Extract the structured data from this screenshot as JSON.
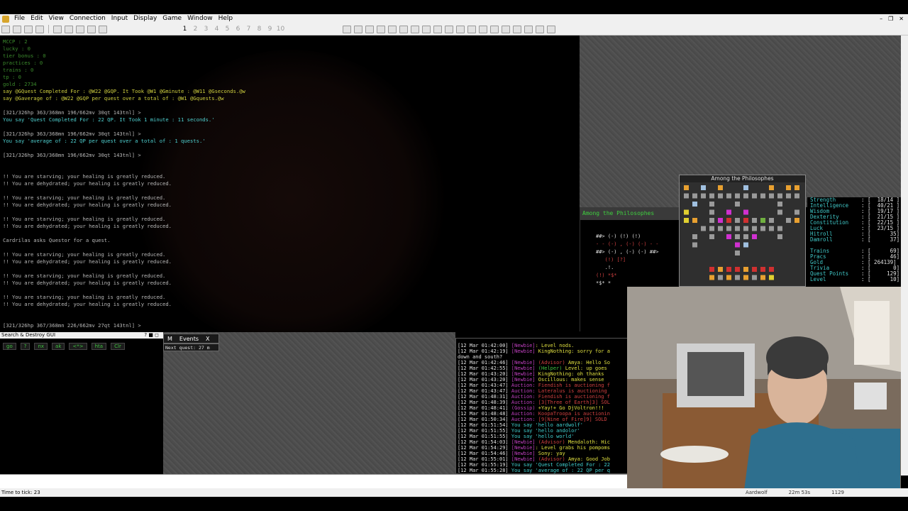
{
  "menu": [
    "File",
    "Edit",
    "View",
    "Connection",
    "Input",
    "Display",
    "Game",
    "Window",
    "Help"
  ],
  "toolbar_numbers": [
    "1",
    "2",
    "3",
    "4",
    "5",
    "6",
    "7",
    "8",
    "9",
    "10"
  ],
  "output": [
    {
      "t": "MCCP : 2",
      "c": "c-green"
    },
    {
      "t": "lucky : 0",
      "c": "c-green"
    },
    {
      "t": "tier bonus : 0",
      "c": "c-green"
    },
    {
      "t": "practices : 0",
      "c": "c-green"
    },
    {
      "t": "trains : 0",
      "c": "c-green"
    },
    {
      "t": "tp : 0",
      "c": "c-green"
    },
    {
      "t": "gold : 2734",
      "c": "c-green"
    },
    {
      "t": "say @GQuest Completed For : @W22 @GQP. It Took @W1 @Gminute : @W11 @Gseconds.@w",
      "c": "c-yellow"
    },
    {
      "t": "say @Gaverage of : @W22 @GQP per quest over a total of : @W1 @Gquests.@w",
      "c": "c-yellow"
    },
    {
      "t": "",
      "c": "c-grey"
    },
    {
      "t": "[321/326hp 363/368mn 196/662mv 30qt 143tnl] >",
      "c": "c-grey"
    },
    {
      "t": "You say 'Quest Completed For : 22 QP. It Took 1 minute : 11 seconds.'",
      "c": "c-cyan"
    },
    {
      "t": "",
      "c": "c-grey"
    },
    {
      "t": "[321/326hp 363/368mn 196/662mv 30qt 143tnl] >",
      "c": "c-grey"
    },
    {
      "t": "You say 'average of : 22 QP per quest over a total of : 1 quests.'",
      "c": "c-cyan"
    },
    {
      "t": "",
      "c": "c-grey"
    },
    {
      "t": "[321/326hp 363/368mn 196/662mv 30qt 143tnl] >",
      "c": "c-grey"
    },
    {
      "t": "",
      "c": "c-grey"
    },
    {
      "t": "",
      "c": "c-grey"
    },
    {
      "t": "!! You are starving; your healing is greatly reduced.",
      "c": "c-grey"
    },
    {
      "t": "!! You are dehydrated; your healing is greatly reduced.",
      "c": "c-grey"
    },
    {
      "t": "",
      "c": "c-grey"
    },
    {
      "t": "!! You are starving; your healing is greatly reduced.",
      "c": "c-grey"
    },
    {
      "t": "!! You are dehydrated; your healing is greatly reduced.",
      "c": "c-grey"
    },
    {
      "t": "",
      "c": "c-grey"
    },
    {
      "t": "!! You are starving; your healing is greatly reduced.",
      "c": "c-grey"
    },
    {
      "t": "!! You are dehydrated; your healing is greatly reduced.",
      "c": "c-grey"
    },
    {
      "t": "",
      "c": "c-grey"
    },
    {
      "t": "Cardrilas asks Questor for a quest.",
      "c": "c-grey"
    },
    {
      "t": "",
      "c": "c-grey"
    },
    {
      "t": "!! You are starving; your healing is greatly reduced.",
      "c": "c-grey"
    },
    {
      "t": "!! You are dehydrated; your healing is greatly reduced.",
      "c": "c-grey"
    },
    {
      "t": "",
      "c": "c-grey"
    },
    {
      "t": "!! You are starving; your healing is greatly reduced.",
      "c": "c-grey"
    },
    {
      "t": "!! You are dehydrated; your healing is greatly reduced.",
      "c": "c-grey"
    },
    {
      "t": "",
      "c": "c-grey"
    },
    {
      "t": "!! You are starving; your healing is greatly reduced.",
      "c": "c-grey"
    },
    {
      "t": "!! You are dehydrated; your healing is greatly reduced.",
      "c": "c-grey"
    },
    {
      "t": "",
      "c": "c-grey"
    },
    {
      "t": "",
      "c": "c-grey"
    },
    {
      "t": "[321/326hp 367/368mn 226/662mv 27qt 143tnl] >",
      "c": "c-grey"
    }
  ],
  "area": {
    "title": "Among the Philosophes",
    "minimap": [
      "##> (-) (!) (!)",
      "- - (-) , (-) (-) - -",
      "##> (-) , (-) (-) ##>",
      "   (!) [?]",
      "   .!.",
      "(!) *$*",
      "*$* *"
    ]
  },
  "map": {
    "title": "Among the Philosophes"
  },
  "stats": [
    {
      "name": "Strength",
      "val": "[  18/14 ]"
    },
    {
      "name": "Intelligence",
      "val": "[  40/21 ]"
    },
    {
      "name": "Wisdom",
      "val": "[  19/17 ]"
    },
    {
      "name": "Dexterity",
      "val": "[  21/15 ]"
    },
    {
      "name": "Constitution",
      "val": "[  22/15 ]"
    },
    {
      "name": "Luck",
      "val": "[  23/15 ]"
    },
    {
      "name": "Hitroll",
      "val": "[      35]"
    },
    {
      "name": "Damroll",
      "val": "[      37]"
    }
  ],
  "stats2": [
    {
      "name": "Trains",
      "val": "[      69]"
    },
    {
      "name": "Pracs",
      "val": "[      46]"
    },
    {
      "name": "Gold",
      "val": "[ 264139]"
    },
    {
      "name": "Trivia",
      "val": "[       0]"
    },
    {
      "name": "Quest Points",
      "val": "[     129]"
    },
    {
      "name": "Level",
      "val": "[      10]"
    }
  ],
  "sd": {
    "title": "Search & Destroy GUI",
    "buttons": [
      "go",
      "?",
      "nx",
      "ak",
      "<*>",
      "hta",
      "Clr"
    ]
  },
  "events": {
    "tab1": "M",
    "tab2": "Events",
    "close": "X",
    "body": "Next quest: 27 m"
  },
  "chat": [
    {
      "ts": "[12 Mar 01:42:00]",
      "parts": [
        {
          "t": " [Newbie]",
          "c": "ch-m"
        },
        {
          "t": ": Level nods.",
          "c": "ch-y"
        }
      ]
    },
    {
      "ts": "[12 Mar 01:42:19]",
      "parts": [
        {
          "t": " [Newbie]",
          "c": "ch-m"
        },
        {
          "t": " KingNothing: sorry for a",
          "c": "ch-y"
        }
      ]
    },
    {
      "ts": "down and south?",
      "parts": []
    },
    {
      "ts": "[12 Mar 01:42:46]",
      "parts": [
        {
          "t": " [Newbie]",
          "c": "ch-m"
        },
        {
          "t": " (Advisor)",
          "c": "ch-r"
        },
        {
          "t": " Amya: Hello So",
          "c": "ch-y"
        }
      ]
    },
    {
      "ts": "[12 Mar 01:42:55]",
      "parts": [
        {
          "t": " [Newbie]",
          "c": "ch-m"
        },
        {
          "t": " (Helper)",
          "c": "ch-g"
        },
        {
          "t": " Level: up goes",
          "c": "ch-y"
        }
      ]
    },
    {
      "ts": "[12 Mar 01:43:20]",
      "parts": [
        {
          "t": " [Newbie]",
          "c": "ch-m"
        },
        {
          "t": " KingNothing: oh thanks",
          "c": "ch-y"
        }
      ]
    },
    {
      "ts": "[12 Mar 01:43:20]",
      "parts": [
        {
          "t": " [Newbie]",
          "c": "ch-m"
        },
        {
          "t": " Oscillous: makes sense",
          "c": "ch-y"
        }
      ]
    },
    {
      "ts": "[12 Mar 01:43:47]",
      "parts": [
        {
          "t": " Auction:",
          "c": "ch-m"
        },
        {
          "t": " Fiendish is auctioning f",
          "c": "ch-r"
        }
      ]
    },
    {
      "ts": "[12 Mar 01:43:47]",
      "parts": [
        {
          "t": " Auction:",
          "c": "ch-m"
        },
        {
          "t": " Lateralus is auctioning",
          "c": "ch-r"
        }
      ]
    },
    {
      "ts": "[12 Mar 01:48:31]",
      "parts": [
        {
          "t": " Auction:",
          "c": "ch-m"
        },
        {
          "t": " Fiendish is auctioning f",
          "c": "ch-r"
        }
      ]
    },
    {
      "ts": "[12 Mar 01:48:39]",
      "parts": [
        {
          "t": " Auction:",
          "c": "ch-m"
        },
        {
          "t": " [3[Three of Earth]3] SOL",
          "c": "ch-r"
        }
      ]
    },
    {
      "ts": "[12 Mar 01:48:41]",
      "parts": [
        {
          "t": " (Gossip)",
          "c": "ch-m"
        },
        {
          "t": " +Yay!+ Go DjVoltron!!!",
          "c": "ch-y"
        }
      ]
    },
    {
      "ts": "[12 Mar 01:48:48]",
      "parts": [
        {
          "t": " Auction:",
          "c": "ch-m"
        },
        {
          "t": " KoopaTroopa is auctionin",
          "c": "ch-r"
        }
      ]
    },
    {
      "ts": "[12 Mar 01:50:34]",
      "parts": [
        {
          "t": " Auction:",
          "c": "ch-m"
        },
        {
          "t": " [9[Nine of Fire]9] SOLD",
          "c": "ch-r"
        }
      ]
    },
    {
      "ts": "[12 Mar 01:51:54]",
      "parts": [
        {
          "t": " You say 'hello aardwolf'",
          "c": "ch-c"
        }
      ]
    },
    {
      "ts": "[12 Mar 01:51:55]",
      "parts": [
        {
          "t": " You say 'hello andolor'",
          "c": "ch-c"
        }
      ]
    },
    {
      "ts": "[12 Mar 01:51:55]",
      "parts": [
        {
          "t": " You say 'hello world'",
          "c": "ch-c"
        }
      ]
    },
    {
      "ts": "[12 Mar 01:54:03]",
      "parts": [
        {
          "t": " [Newbie]",
          "c": "ch-m"
        },
        {
          "t": " (Advisor)",
          "c": "ch-r"
        },
        {
          "t": " Mendaloth: Hic",
          "c": "ch-y"
        }
      ]
    },
    {
      "ts": "[12 Mar 01:54:29]",
      "parts": [
        {
          "t": " [Newbie]",
          "c": "ch-m"
        },
        {
          "t": ": Level grabs his pompoms",
          "c": "ch-y"
        }
      ]
    },
    {
      "ts": "[12 Mar 01:54:46]",
      "parts": [
        {
          "t": " [Newbie]",
          "c": "ch-m"
        },
        {
          "t": " Sony: yay",
          "c": "ch-y"
        }
      ]
    },
    {
      "ts": "[12 Mar 01:55:01]",
      "parts": [
        {
          "t": " [Newbie]",
          "c": "ch-m"
        },
        {
          "t": " (Advisor)",
          "c": "ch-r"
        },
        {
          "t": " Amya: Good Job",
          "c": "ch-y"
        }
      ]
    },
    {
      "ts": "[12 Mar 01:55:19]",
      "parts": [
        {
          "t": " You say 'Quest Completed For : 22",
          "c": "ch-c"
        }
      ]
    },
    {
      "ts": "[12 Mar 01:55:28]",
      "parts": [
        {
          "t": " You say 'average of : 22 QP per q",
          "c": "ch-c"
        }
      ]
    }
  ],
  "status": {
    "left": "Time to tick: 23",
    "char": "Aardwolf",
    "time": "22m 53s",
    "right": "1129"
  }
}
